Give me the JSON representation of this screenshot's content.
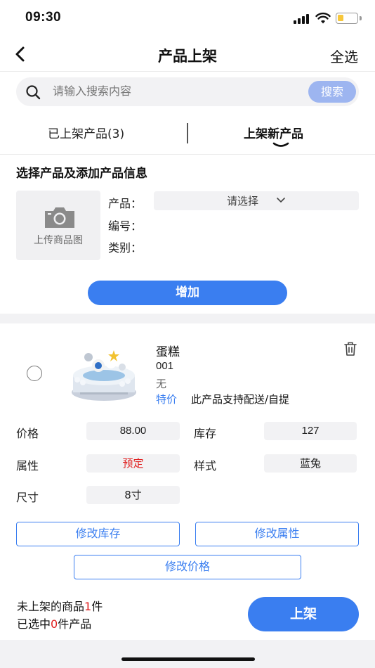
{
  "status_bar": {
    "time": "09:30"
  },
  "nav": {
    "title": "产品上架",
    "right_action": "全选"
  },
  "search": {
    "placeholder": "请输入搜索内容",
    "button_label": "搜索"
  },
  "tabs": [
    {
      "label": "已上架产品(3)"
    },
    {
      "label": "上架新产品"
    }
  ],
  "form": {
    "section_title": "选择产品及添加产品信息",
    "upload_label": "上传商品图",
    "product_label": "产品：",
    "select_placeholder": "请选择",
    "code_label": "编号：",
    "category_label": "类别：",
    "add_button": "增加"
  },
  "product": {
    "name": "蛋糕",
    "code": "001",
    "description": "无",
    "tag": "特价",
    "delivery_note": "此产品支持配送/自提",
    "price_label": "价格",
    "price": "88.00",
    "stock_label": "库存",
    "stock": "127",
    "attribute_label": "属性",
    "attribute": "预定",
    "style_label": "样式",
    "style": "蓝兔",
    "size_label": "尺寸",
    "size": "8寸",
    "btn_edit_stock": "修改库存",
    "btn_edit_attribute": "修改属性",
    "btn_edit_price": "修改价格"
  },
  "footer": {
    "unlisted_prefix": "未上架的商品",
    "unlisted_count": "1",
    "unlisted_suffix": "件",
    "selected_prefix": "已选中",
    "selected_count": "0",
    "selected_suffix": "件产品",
    "list_button": "上架"
  },
  "colors": {
    "accent": "#3a7ef0",
    "search_button": "#9db5f0",
    "warning": "#e02020",
    "battery": "#f7c73b"
  }
}
